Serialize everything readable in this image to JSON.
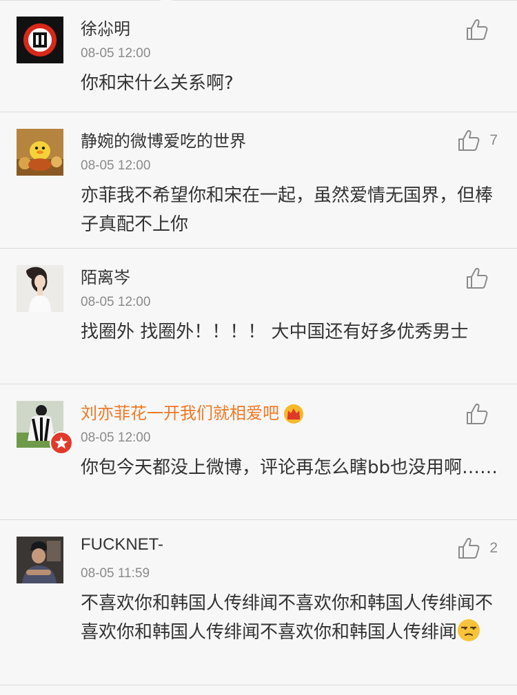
{
  "comments": [
    {
      "name": "徐尛明",
      "time": "08-05 12:00",
      "text": "你和宋什么关系啊?",
      "likes": "",
      "avatar": "red-stamp-avatar",
      "vip": false
    },
    {
      "name": "静婉的微博爱吃的世界",
      "time": "08-05 12:00",
      "text": "亦菲我不希望你和宋在一起，虽然爱情无国界，但棒子真配不上你",
      "likes": "7",
      "avatar": "duck-photo-avatar",
      "vip": false
    },
    {
      "name": "陌离岑",
      "time": "08-05 12:00",
      "text": "找圈外 找圈外！！！！ 大中国还有好多优秀男士",
      "likes": "",
      "avatar": "woman-photo-avatar",
      "vip": false
    },
    {
      "name": "刘亦菲花一开我们就相爱吧",
      "time": "08-05 12:00",
      "text": "你包今天都没上微博，评论再怎么瞎bb也没用啊……",
      "likes": "",
      "avatar": "soccer-player-avatar",
      "vip": true
    },
    {
      "name": "FUCKNET-",
      "time": "08-05 11:59",
      "text": "不喜欢你和韩国人传绯闻不喜欢你和韩国人传绯闻不喜欢你和韩国人传绯闻不喜欢你和韩国人传绯闻",
      "likes": "2",
      "avatar": "man-photo-avatar",
      "vip": false,
      "trailing_emoji": "unamused-face-icon"
    }
  ],
  "colors": {
    "vip_name": "#f07824",
    "badge_red": "#e03a2a",
    "text": "#333333",
    "meta": "#8a8a8a"
  }
}
